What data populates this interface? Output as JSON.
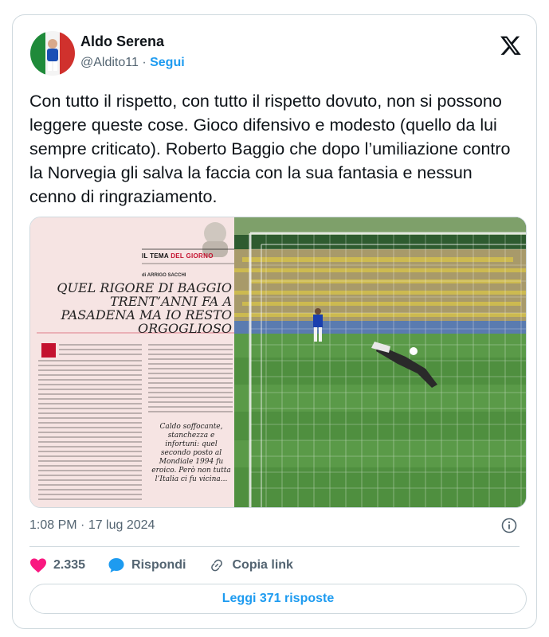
{
  "author": {
    "name": "Aldo Serena",
    "handle": "@Aldito11",
    "separator": " · ",
    "follow_label": "Segui"
  },
  "tweet": {
    "text": "Con tutto il rispetto, con tutto il rispetto dovuto, non si possono leggere queste cose. Gioco difensivo e modesto (quello da lui sempre criticato). Roberto Baggio che dopo l’umiliazione contro la Norvegia gli salva la faccia con la sua fantasia e nessun cenno di ringraziamento."
  },
  "media": {
    "section": "IL TEMA",
    "section_highlight": "DEL GIORNO",
    "byline": "di ARRIGO SACCHI",
    "headline": "QUEL RIGORE DI BAGGIO TRENT’ANNI FA A PASADENA MA IO RESTO ORGOGLIOSO",
    "subhead": "Caldo soffocante, stanchezza e infortuni: quel secondo posto al Mondiale 1994 fu eroico. Però non tutta l’Italia ci fu vicina..."
  },
  "meta": {
    "time": "1:08 PM",
    "separator": " · ",
    "date": "17 lug 2024"
  },
  "actions": {
    "likes": "2.335",
    "reply_label": "Rispondi",
    "copy_label": "Copia link"
  },
  "replies_button": "Leggi 371 risposte",
  "colors": {
    "accent": "#1d9bf0",
    "like": "#f91880",
    "text": "#0f1419",
    "muted": "#536471",
    "border": "#cfd9de"
  },
  "icons": [
    "x-logo-icon",
    "info-icon",
    "heart-icon",
    "reply-bubble-icon",
    "link-icon"
  ]
}
